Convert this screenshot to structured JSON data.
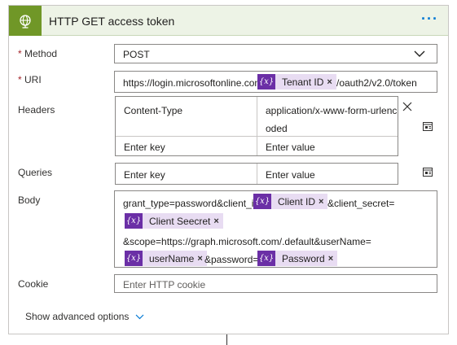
{
  "header": {
    "title": "HTTP GET access token",
    "menu": "···"
  },
  "method": {
    "label": "Method",
    "required_mark": "*",
    "value": "POST"
  },
  "uri": {
    "label": "URI",
    "required_mark": "*",
    "prefix": "https://login.microsoftonline.com/",
    "token": "Tenant ID",
    "suffix": "/oauth2/v2.0/token"
  },
  "headers": {
    "label": "Headers",
    "row1": {
      "key": "Content-Type",
      "value_line1": "application/x-www-form-urlenc",
      "value_line2": "oded"
    },
    "key_placeholder": "Enter key",
    "value_placeholder": "Enter value"
  },
  "queries": {
    "label": "Queries",
    "key_placeholder": "Enter key",
    "value_placeholder": "Enter value"
  },
  "body": {
    "label": "Body",
    "text1": "grant_type=password&client_id=",
    "token1": "Client ID",
    "text2": "&client_secret=",
    "token2": "Client Seecret",
    "text3": "&scope=https://graph.microsoft.com/.default&userName=",
    "token3": "userName",
    "text4": "&password=",
    "token4": "Password"
  },
  "cookie": {
    "label": "Cookie",
    "placeholder": "Enter HTTP cookie"
  },
  "advanced": {
    "label": "Show advanced options"
  },
  "token_icon_text": "{x}",
  "close_glyph": "×",
  "colors": {
    "accent": "#709727",
    "header_bg": "#edf3e6",
    "token_icon": "#6b2fa6",
    "token_bg": "#e8dcf2",
    "link_blue": "#0078d4"
  }
}
